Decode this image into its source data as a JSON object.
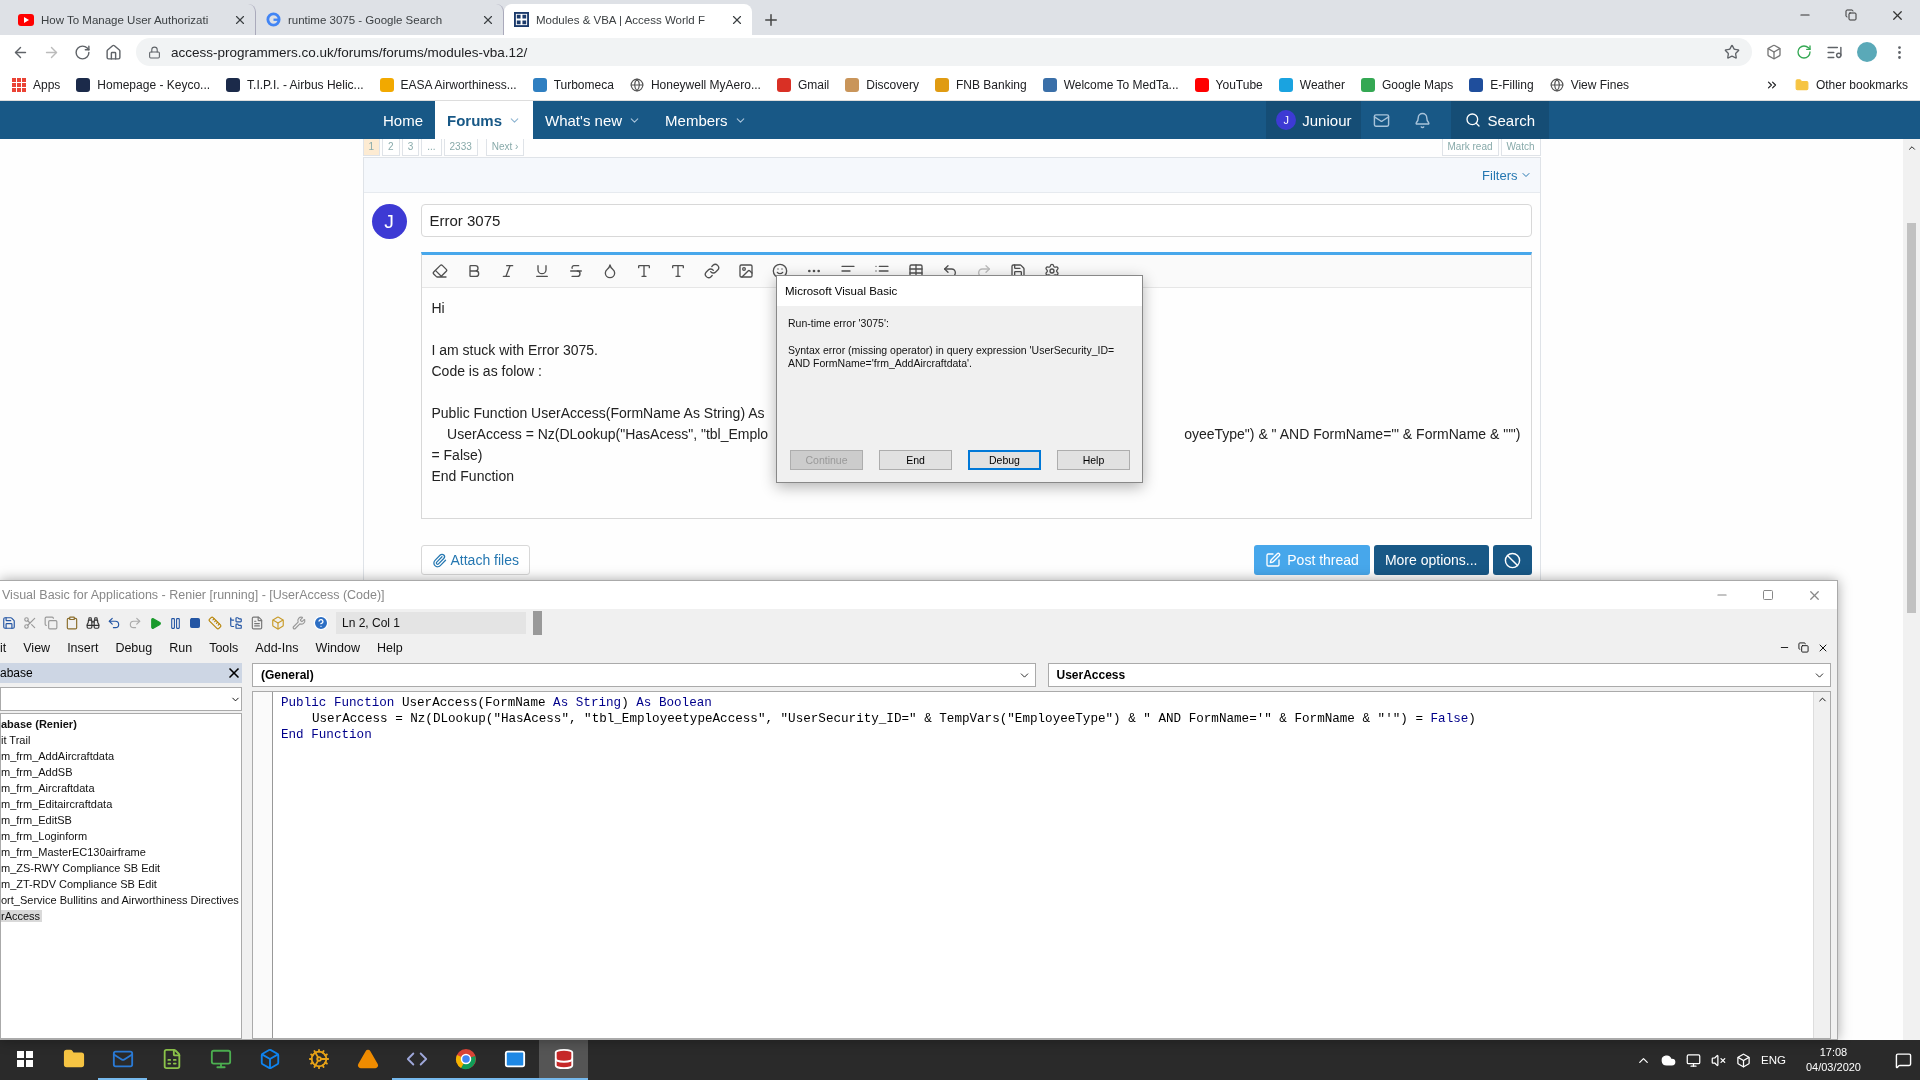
{
  "browser": {
    "tabs": [
      {
        "title": "How To Manage User Authorizati",
        "kind": "video",
        "selected": false
      },
      {
        "title": "runtime 3075 - Google Search",
        "kind": "search",
        "selected": false
      },
      {
        "title": "Modules & VBA | Access World F",
        "kind": "site",
        "selected": true
      }
    ],
    "address": "access-programmers.co.uk/forums/forums/modules-vba.12/",
    "bookmarks": [
      {
        "label": "Apps",
        "kind": "grid",
        "color": "#ea4335"
      },
      {
        "label": "Homepage - Keyco...",
        "kind": "site",
        "color": "#1b2a4a"
      },
      {
        "label": "T.I.P.I. - Airbus Helic...",
        "kind": "site",
        "color": "#1b2a4a"
      },
      {
        "label": "EASA Airworthiness...",
        "kind": "site",
        "color": "#f2a900"
      },
      {
        "label": "Turbomeca",
        "kind": "site",
        "color": "#2f7fc1"
      },
      {
        "label": "Honeywell MyAero...",
        "kind": "globe",
        "color": "#555555"
      },
      {
        "label": "Gmail",
        "kind": "site",
        "color": "#d93025"
      },
      {
        "label": "Discovery",
        "kind": "site",
        "color": "#c9955a"
      },
      {
        "label": "FNB Banking",
        "kind": "site",
        "color": "#e09b12"
      },
      {
        "label": "Welcome To MedTa...",
        "kind": "site",
        "color": "#3a6fa8"
      },
      {
        "label": "YouTube",
        "kind": "site",
        "color": "#ff0000"
      },
      {
        "label": "Weather",
        "kind": "site",
        "color": "#1aa3e0"
      },
      {
        "label": "Google Maps",
        "kind": "site",
        "color": "#34a853"
      },
      {
        "label": "E-Filling",
        "kind": "site",
        "color": "#1f4e9c"
      },
      {
        "label": "View Fines",
        "kind": "globe",
        "color": "#555555"
      }
    ],
    "other_bookmarks": "Other bookmarks"
  },
  "forum": {
    "nav": [
      {
        "label": "Home",
        "selected": false,
        "has_menu": false
      },
      {
        "label": "Forums",
        "selected": true,
        "has_menu": true
      },
      {
        "label": "What's new",
        "selected": false,
        "has_menu": true
      },
      {
        "label": "Members",
        "selected": false,
        "has_menu": true
      }
    ],
    "user_initial": "J",
    "user": "Juniour",
    "search": "Search",
    "pages": [
      {
        "label": "1",
        "selected": true
      },
      {
        "label": "2",
        "selected": false
      },
      {
        "label": "3",
        "selected": false
      },
      {
        "label": "...",
        "selected": false
      },
      {
        "label": "2333",
        "selected": false
      }
    ],
    "next": "Next ›",
    "actions": [
      "Mark read",
      "Watch"
    ],
    "filters": "Filters",
    "avatar_initial": "J",
    "thread_title": "Error 3075",
    "editor_paragraphs": [
      {
        "lines": [
          {
            "text": "Hi"
          }
        ]
      },
      {
        "lines": [
          {
            "text": "I am stuck with Error 3075."
          },
          {
            "text": "Code is as folow :"
          }
        ]
      },
      {
        "lines": [
          {
            "text": "Public Function UserAccess(FormName As String) As"
          },
          {
            "text": "    UserAccess = Nz(DLookup(\"HasAcess\", \"tbl_Emplo",
            "text_right": "oyeeType\") & \" AND FormName='\" & FormName & \"'\")"
          },
          {
            "text": "= False)"
          },
          {
            "text": "End Function"
          }
        ]
      }
    ],
    "attach": "Attach files",
    "post": "Post thread",
    "more": "More options..."
  },
  "dialog": {
    "title": "Microsoft Visual Basic",
    "error": "Run-time error '3075':",
    "message": "Syntax error (missing operator) in query expression 'UserSecurity_ID= AND FormName='frm_AddAircraftdata'.",
    "buttons": [
      {
        "label": "Continue",
        "disabled": true,
        "default": false
      },
      {
        "label": "End",
        "disabled": false,
        "default": false
      },
      {
        "label": "Debug",
        "disabled": false,
        "default": true
      },
      {
        "label": "Help",
        "disabled": false,
        "default": false
      }
    ]
  },
  "vba": {
    "title": "Visual Basic for Applications - Renier [running] - [UserAccess (Code)]",
    "position": "Ln 2, Col 1",
    "menu": [
      "it",
      "View",
      "Insert",
      "Debug",
      "Run",
      "Tools",
      "Add-Ins",
      "Window",
      "Help"
    ],
    "project_title": "abase",
    "tree": [
      {
        "label": "abase (Renier)",
        "selected": false,
        "children": [
          {
            "label": "it Trail",
            "selected": false
          },
          {
            "label": "m_frm_AddAircraftdata",
            "selected": false
          },
          {
            "label": "m_frm_AddSB",
            "selected": false
          },
          {
            "label": "m_frm_Aircraftdata",
            "selected": false
          },
          {
            "label": "m_frm_Editaircraftdata",
            "selected": false
          },
          {
            "label": "m_frm_EditSB",
            "selected": false
          },
          {
            "label": "m_frm_Loginform",
            "selected": false
          },
          {
            "label": "m_frm_MasterEC130airframe",
            "selected": false
          },
          {
            "label": "m_ZS-RWY Compliance SB Edit",
            "selected": false
          },
          {
            "label": "m_ZT-RDV Compliance SB Edit",
            "selected": false
          },
          {
            "label": "ort_Service Bullitins and Airworthiness Directives",
            "selected": false
          },
          {
            "label": "rAccess",
            "selected": true
          }
        ]
      }
    ],
    "object": "(General)",
    "procedure": "UserAccess",
    "code": [
      {
        "indent": false,
        "tokens": [
          {
            "text": "Public Function",
            "kind": "keyword"
          },
          {
            "text": " UserAccess(FormName ",
            "kind": "plain"
          },
          {
            "text": "As String",
            "kind": "keyword"
          },
          {
            "text": ") ",
            "kind": "plain"
          },
          {
            "text": "As Boolean",
            "kind": "keyword"
          }
        ]
      },
      {
        "indent": true,
        "tokens": [
          {
            "text": "UserAccess = Nz(DLookup(\"HasAcess\", \"tbl_EmployeetypeAccess\", \"UserSecurity_ID=\" & TempVars(\"EmployeeType\") & \" AND FormName='\" & FormName & \"'\") = ",
            "kind": "plain"
          },
          {
            "text": "False",
            "kind": "keyword"
          },
          {
            "text": ")",
            "kind": "plain"
          }
        ]
      },
      {
        "indent": false,
        "tokens": [
          {
            "text": "End Function",
            "kind": "keyword"
          }
        ]
      }
    ]
  },
  "taskbar": {
    "apps": [
      {
        "kind": "folder",
        "running": false,
        "selected": false
      },
      {
        "kind": "mail",
        "running": true,
        "selected": false
      },
      {
        "kind": "sheet",
        "running": false,
        "selected": false
      },
      {
        "kind": "monitor",
        "running": false,
        "selected": false
      },
      {
        "kind": "box",
        "running": false,
        "selected": false
      },
      {
        "kind": "gear",
        "running": false,
        "selected": false
      },
      {
        "kind": "cone",
        "running": false,
        "selected": false
      },
      {
        "kind": "code",
        "running": true,
        "selected": false
      },
      {
        "kind": "browser",
        "running": true,
        "selected": false
      },
      {
        "kind": "envelope",
        "running": true,
        "selected": false
      },
      {
        "kind": "database",
        "running": true,
        "selected": true
      }
    ],
    "language": "ENG",
    "time": "17:08",
    "date": "04/03/2020"
  }
}
